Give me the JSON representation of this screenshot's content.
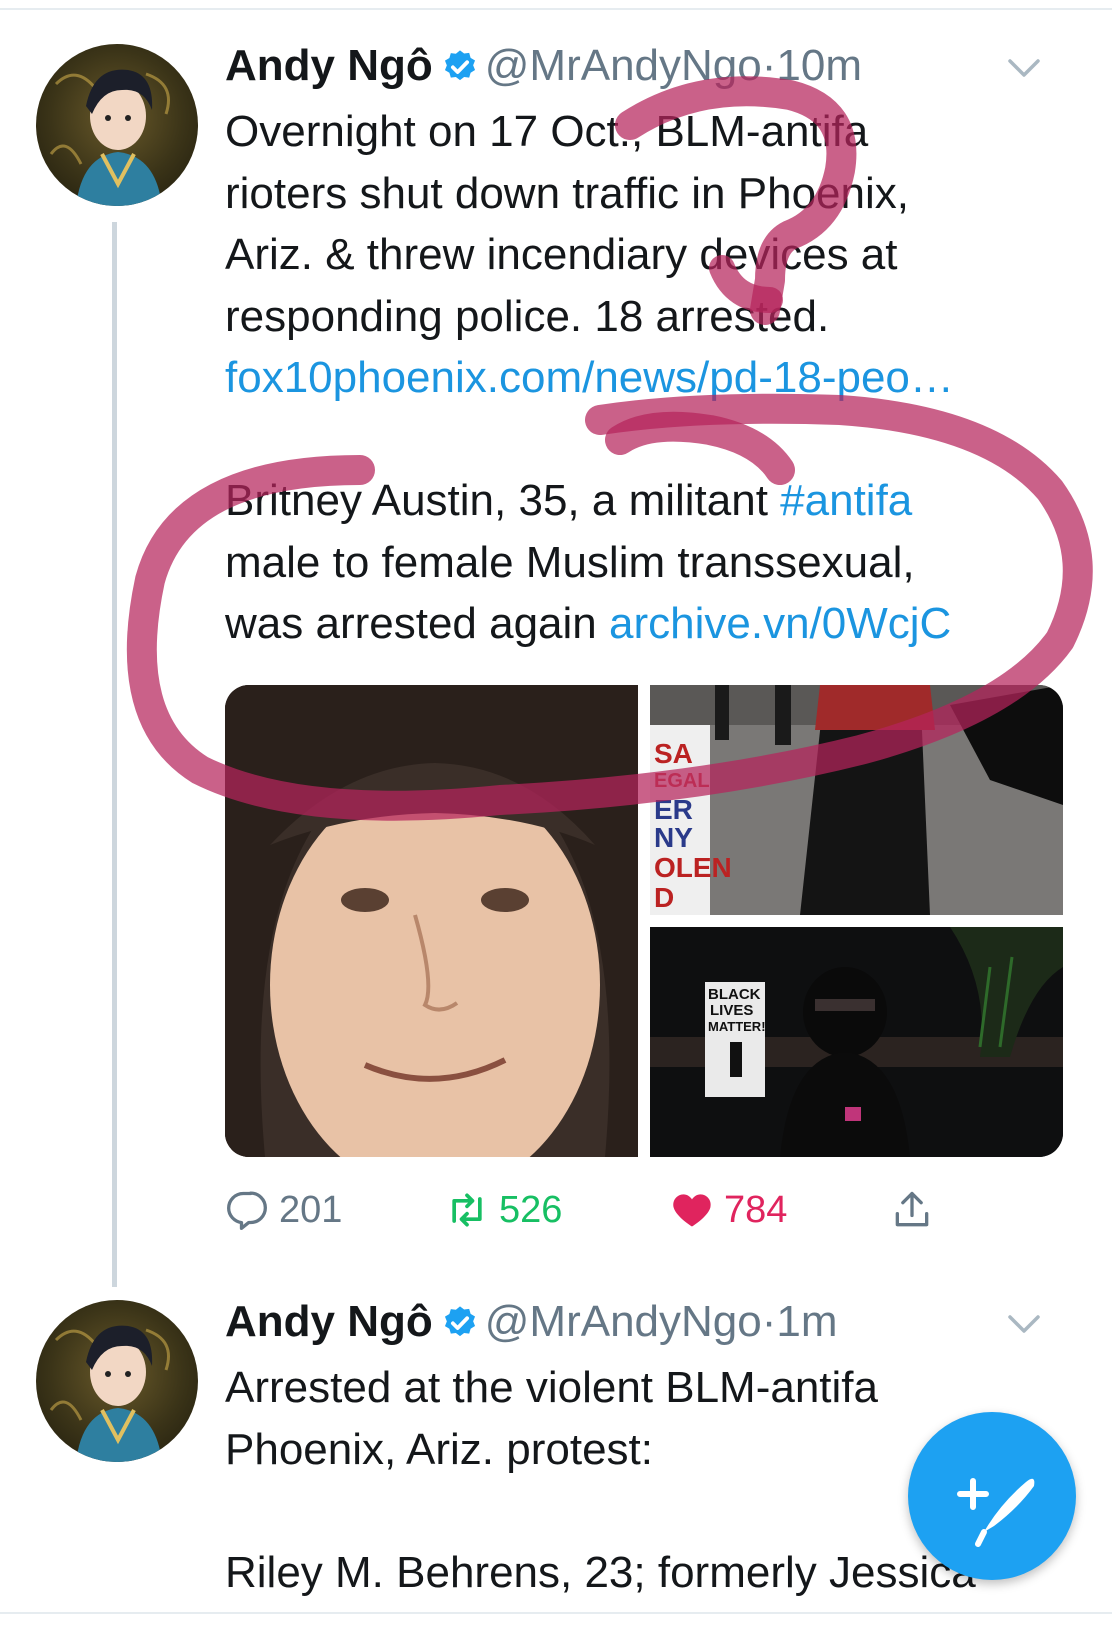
{
  "tweets": [
    {
      "name": "Andy Ngô",
      "handle": "@MrAndyNgo",
      "separator": "·",
      "time": "10m",
      "text_line1": "Overnight on 17 Oct., BLM-antifa",
      "text_line2": "rioters shut down traffic in Phoenix,",
      "text_line3": "Ariz. & threw incendiary devices at",
      "text_line4": "responding police. 18 arrested.",
      "link1": "fox10phoenix.com/news/pd-18-peo…",
      "para2_line1": "Britney Austin, 35, a militant ",
      "hashtag": "#antifa",
      "para2_line2": "male to female Muslim transsexual,",
      "para2_line3": "was arrested again ",
      "link2": "archive.vn/0WcjC",
      "media": {
        "sign_top_lines": [
          "SA",
          "EGAL",
          "ER",
          "NY",
          "OLEN",
          "D"
        ],
        "sign_bottom_lines": [
          "BLACK",
          "LIVES",
          "MATTER!"
        ]
      },
      "actions": {
        "replies": "201",
        "retweets": "526",
        "likes": "784"
      }
    },
    {
      "name": "Andy Ngô",
      "handle": "@MrAndyNgo",
      "separator": "·",
      "time": "1m",
      "text_line1": "Arrested at the violent BLM-antifa",
      "text_line2": "Phoenix, Ariz. protest:",
      "text_line3": "Riley M. Behrens, 23; formerly Jessica"
    }
  ],
  "colors": {
    "link": "#1b95e0",
    "verified": "#1da1f2",
    "retweet": "#17bf63",
    "like": "#e0245e",
    "annotation": "#b5245c",
    "fab": "#1da1f2"
  },
  "icons": [
    "verified-badge-icon",
    "chevron-down-icon",
    "reply-icon",
    "retweet-icon",
    "heart-icon",
    "share-icon",
    "compose-tweet-icon"
  ]
}
